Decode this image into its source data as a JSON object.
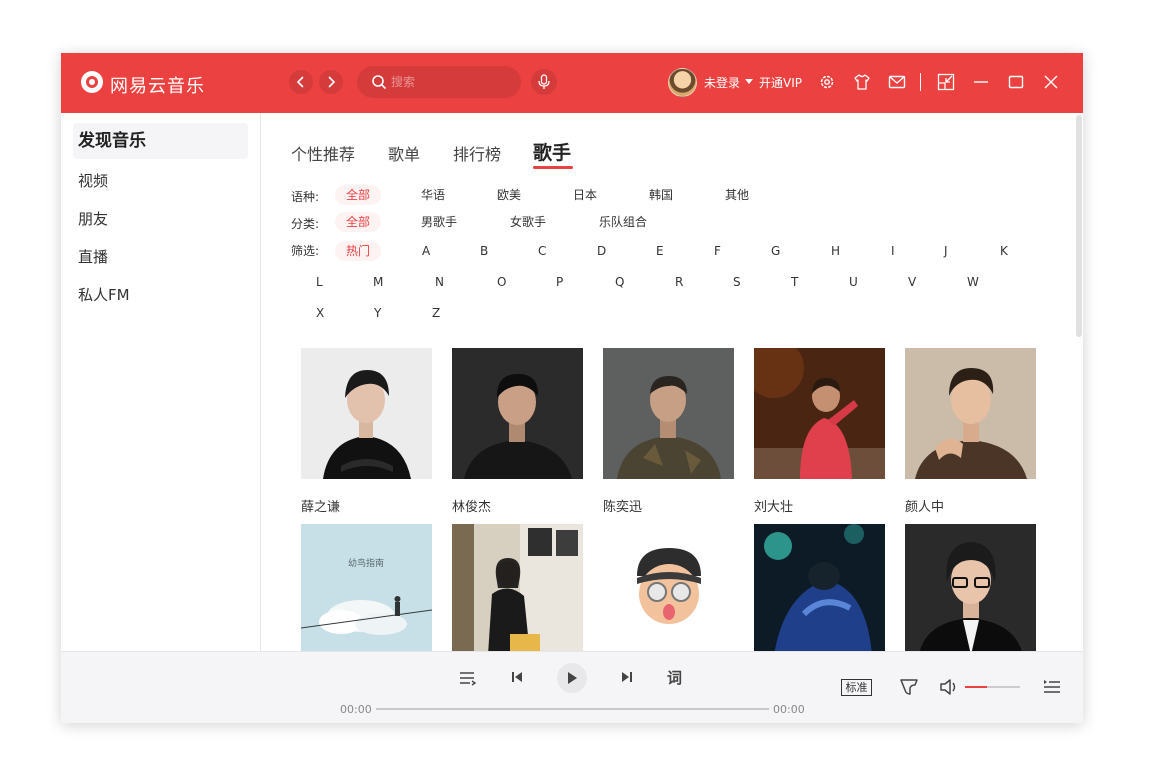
{
  "app": {
    "title": "网易云音乐"
  },
  "search": {
    "placeholder": "搜索"
  },
  "user": {
    "login_label": "未登录",
    "vip_label": "开通VIP"
  },
  "sidebar": {
    "items": [
      {
        "label": "发现音乐",
        "active": true
      },
      {
        "label": "视频"
      },
      {
        "label": "朋友"
      },
      {
        "label": "直播"
      },
      {
        "label": "私人FM"
      }
    ]
  },
  "tabs": [
    {
      "label": "个性推荐"
    },
    {
      "label": "歌单"
    },
    {
      "label": "排行榜"
    },
    {
      "label": "歌手",
      "active": true
    }
  ],
  "filters": {
    "language": {
      "label": "语种:",
      "options": [
        "全部",
        "华语",
        "欧美",
        "日本",
        "韩国",
        "其他"
      ],
      "selected": "全部"
    },
    "category": {
      "label": "分类:",
      "options": [
        "全部",
        "男歌手",
        "女歌手",
        "乐队组合"
      ],
      "selected": "全部"
    },
    "initial": {
      "label": "筛选:",
      "options": [
        "热门",
        "A",
        "B",
        "C",
        "D",
        "E",
        "F",
        "G",
        "H",
        "I",
        "J",
        "K",
        "L",
        "M",
        "N",
        "O",
        "P",
        "Q",
        "R",
        "S",
        "T",
        "U",
        "V",
        "W",
        "X",
        "Y",
        "Z"
      ],
      "selected": "热门"
    }
  },
  "artists": [
    {
      "name": "薛之谦"
    },
    {
      "name": "林俊杰"
    },
    {
      "name": "陈奕迅"
    },
    {
      "name": "刘大壮"
    },
    {
      "name": "颜人中"
    },
    {
      "name": "",
      "cover_text": "幼鸟指南"
    },
    {
      "name": ""
    },
    {
      "name": ""
    },
    {
      "name": ""
    },
    {
      "name": ""
    }
  ],
  "player": {
    "current_time": "00:00",
    "total_time": "00:00",
    "lyrics_label": "词",
    "quality_label": "标准",
    "volume": 0.4
  },
  "colors": {
    "accent": "#ec4141",
    "sidebar_active_bg": "#f5f5f7"
  }
}
